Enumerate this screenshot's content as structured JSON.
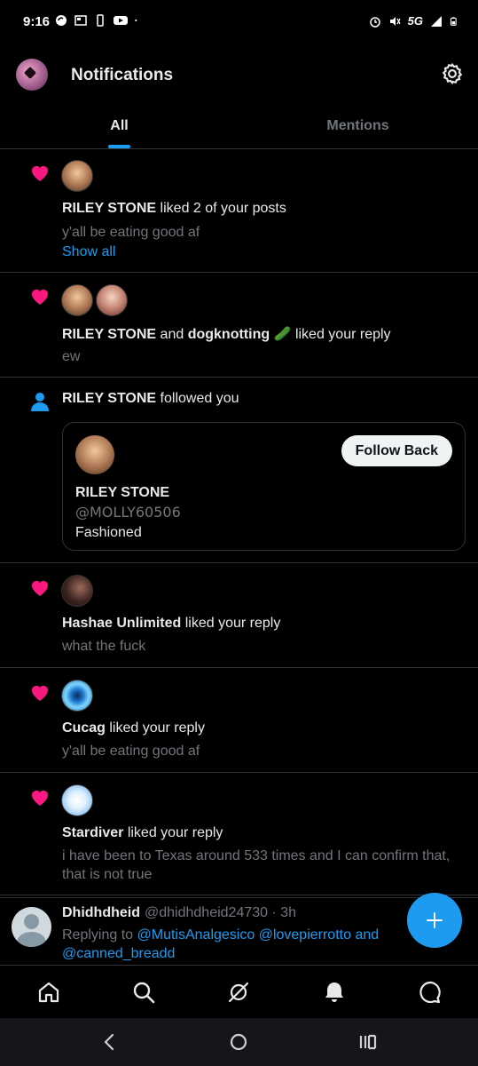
{
  "status_bar": {
    "time": "9:16",
    "network": "5G"
  },
  "header": {
    "title": "Notifications"
  },
  "tabs": [
    {
      "label": "All"
    },
    {
      "label": "Mentions"
    }
  ],
  "notifications": [
    {
      "type": "like",
      "actor": "RILEY STONE",
      "action": " liked 2 of your posts",
      "excerpt": "y'all be eating good af",
      "link": "Show all"
    },
    {
      "type": "like",
      "actor": "RILEY STONE",
      "connector": " and ",
      "actor2": "dogknotting",
      "emoji": "🥒",
      "action": " liked your reply",
      "excerpt": "ew"
    },
    {
      "type": "follow",
      "actor": "RILEY STONE",
      "action": " followed you",
      "card": {
        "name": "RILEY STONE",
        "handle": "@MOLLY60506",
        "bio": "Fashioned",
        "button": "Follow Back"
      }
    },
    {
      "type": "like",
      "actor": "Hashae Unlimited",
      "action": " liked your reply",
      "excerpt": "what the fuck"
    },
    {
      "type": "like",
      "actor": "Cucag",
      "action": " liked your reply",
      "excerpt": "y'all be eating good af"
    },
    {
      "type": "like",
      "actor": "Stardiver",
      "action": " liked your reply",
      "excerpt_line1": "i have been to Texas around 533 times and I can confirm that,",
      "excerpt_line2": "that is not true"
    }
  ],
  "reply": {
    "name": "Dhidhdheid",
    "handle": "@dhidhdheid24730",
    "time": " · 3h",
    "replying_prefix": "Replying to ",
    "mention1": "@MutisAnalgesico",
    "mention2": "@lovepierrotto",
    "and": " and",
    "mention3": "@canned_breadd"
  },
  "colors": {
    "accent": "#1d9bf0",
    "like": "#f91880",
    "background": "#000000"
  },
  "icons": [
    "home-icon",
    "search-icon",
    "grok-icon",
    "bell-icon",
    "messages-icon"
  ]
}
